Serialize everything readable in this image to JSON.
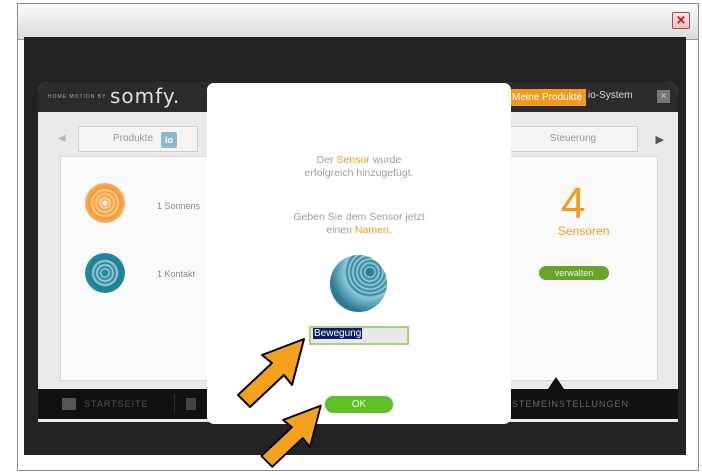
{
  "window": {
    "close_glyph": "×"
  },
  "app": {
    "brand_small": "HOME MOTION BY",
    "brand": "somfy.",
    "nav": {
      "meine_produkte": "Meine Produkte",
      "separator": "|",
      "io_system": "io-System"
    },
    "tabs": {
      "produkte": "Produkte",
      "produkte_badge": "io",
      "steuerung": "Steuerung"
    },
    "rows": [
      {
        "label": "1 Sonnens"
      },
      {
        "label": "1 Kontakt"
      }
    ],
    "count": {
      "value": "4",
      "label": "Sensoren"
    },
    "verwalten": "verwalten",
    "bottom": {
      "start": "STARTSEITE",
      "systemeinstellungen": "SYSTEMEINSTELLUNGEN"
    }
  },
  "modal": {
    "message1": {
      "pre": "Der ",
      "highlight": "Sensor",
      "post": " wurde",
      "line2": "erfolgreich hinzugefügt."
    },
    "message2": {
      "line1": "Geben Sie dem Sensor jetzt",
      "pre": "einen ",
      "highlight": "Namen",
      "post": "."
    },
    "input_value": "Bewegung",
    "ok_label": "OK"
  },
  "colors": {
    "accent": "#f29a1b",
    "ok_green": "#5fbf27",
    "sphere_teal": "#2e7e97"
  },
  "icons": [
    "close-icon",
    "home-icon",
    "cursor-arrow-icon"
  ]
}
